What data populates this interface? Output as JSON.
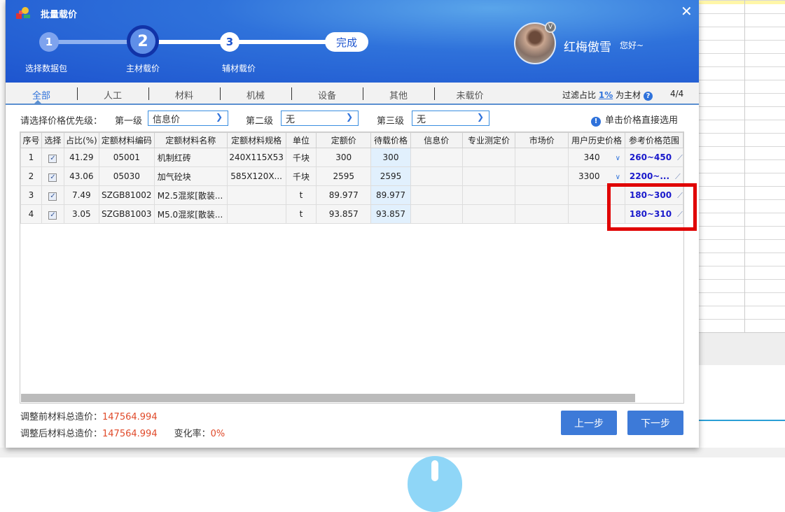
{
  "dialog": {
    "title": "批量载价",
    "close_icon": "close-icon"
  },
  "steps": [
    {
      "num": "1",
      "label": "选择数据包"
    },
    {
      "num": "2",
      "label": "主材载价"
    },
    {
      "num": "3",
      "label": "辅材载价"
    },
    {
      "num": "完成",
      "label": ""
    }
  ],
  "current_step": 2,
  "user": {
    "name": "红梅傲雪",
    "greeting": "您好~",
    "badge": "V"
  },
  "tabs": [
    "全部",
    "人工",
    "材料",
    "机械",
    "设备",
    "其他",
    "未载价"
  ],
  "active_tab": "全部",
  "filter": {
    "prefix": "过滤占比",
    "value": "1%",
    "suffix": "为主材",
    "help": "?",
    "count": "4/4"
  },
  "priority": {
    "label": "请选择价格优先级：",
    "level1_label": "第一级",
    "level1_value": "信息价",
    "level2_label": "第二级",
    "level2_value": "无",
    "level3_label": "第三级",
    "level3_value": "无"
  },
  "hint": {
    "icon": "!",
    "text": "单击价格直接选用"
  },
  "table": {
    "columns": [
      "序号",
      "选择",
      "占比(%)",
      "定额材料编码",
      "定额材料名称",
      "定额材料规格",
      "单位",
      "定额价",
      "待载价格",
      "信息价",
      "专业测定价",
      "市场价",
      "用户历史价格",
      "参考价格范围"
    ],
    "rows": [
      {
        "no": "1",
        "checked": true,
        "ratio": "41.29",
        "code": "05001",
        "name": "机制红砖",
        "spec": "240X115X53",
        "unit": "千块",
        "quota": "300",
        "pending": "300",
        "info": "",
        "pro": "",
        "market": "",
        "history": "340",
        "range": "260~450"
      },
      {
        "no": "2",
        "checked": true,
        "ratio": "43.06",
        "code": "05030",
        "name": "加气砼块",
        "spec": "585X120X...",
        "unit": "千块",
        "quota": "2595",
        "pending": "2595",
        "info": "",
        "pro": "",
        "market": "",
        "history": "3300",
        "range": "2200~..."
      },
      {
        "no": "3",
        "checked": true,
        "ratio": "7.49",
        "code": "SZGB81002",
        "name": "M2.5混浆[散装...",
        "spec": "",
        "unit": "t",
        "quota": "89.977",
        "pending": "89.977",
        "info": "",
        "pro": "",
        "market": "",
        "history": "",
        "range": "180~300"
      },
      {
        "no": "4",
        "checked": true,
        "ratio": "3.05",
        "code": "SZGB81003",
        "name": "M5.0混浆[散装...",
        "spec": "",
        "unit": "t",
        "quota": "93.857",
        "pending": "93.857",
        "info": "",
        "pro": "",
        "market": "",
        "history": "",
        "range": "180~310"
      }
    ]
  },
  "summary": {
    "before_label": "调整前材料总造价：",
    "before_value": "147564.994",
    "after_label": "调整后材料总造价：",
    "after_value": "147564.994",
    "rate_label": "变化率：",
    "rate_value": "0%"
  },
  "buttons": {
    "prev": "上一步",
    "next": "下一步"
  },
  "colors": {
    "accent": "#2f72db",
    "header": "#1e55cf",
    "highlight": "#e00000",
    "price": "#e04a2a",
    "range": "#1a1acc"
  }
}
